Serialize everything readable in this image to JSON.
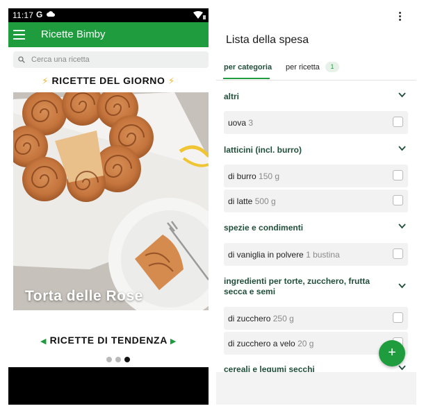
{
  "left": {
    "status": {
      "time": "11:17",
      "g": "G"
    },
    "app_title": "Ricette Bimby",
    "search_placeholder": "Cerca una ricetta",
    "section_daily": "RICETTE DEL GIORNO",
    "hero_caption": "Torta delle Rose",
    "section_trending": "RICETTE DI TENDENZA",
    "carousel": {
      "pages": 3,
      "active_index": 3
    }
  },
  "right": {
    "title": "Lista della spesa",
    "tabs": [
      {
        "label": "per categoria",
        "active": true
      },
      {
        "label": "per ricetta",
        "count": "1"
      }
    ],
    "categories": [
      {
        "name": "altri",
        "items": [
          {
            "name": "uova",
            "qty": "3"
          }
        ]
      },
      {
        "name": "latticini (incl. burro)",
        "items": [
          {
            "name": "di burro",
            "qty": "150 g"
          },
          {
            "name": "di latte",
            "qty": "500 g"
          }
        ]
      },
      {
        "name": "spezie e condimenti",
        "items": [
          {
            "name": "di vaniglia in polvere",
            "qty": "1 bustina"
          }
        ]
      },
      {
        "name": "ingredienti per torte, zucchero, frutta secca e semi",
        "items": [
          {
            "name": "di zucchero",
            "qty": "250 g"
          },
          {
            "name": "di zucchero a velo",
            "qty": "20 g"
          }
        ]
      },
      {
        "name": "cereali e legumi secchi",
        "items": []
      }
    ],
    "fab": "+"
  },
  "colors": {
    "brand_green": "#1e9c3e",
    "category_text": "#1f4f3a",
    "bolt": "#f2b52a"
  }
}
